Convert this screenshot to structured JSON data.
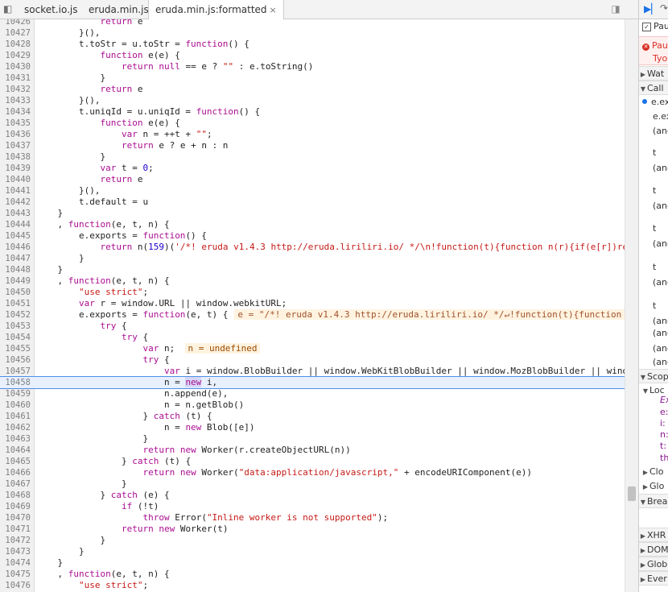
{
  "tabs": [
    {
      "label": "socket.io.js"
    },
    {
      "label": "eruda.min.js"
    },
    {
      "label": "eruda.min.js:formatted",
      "close": "×"
    }
  ],
  "code_lines": [
    {
      "n": "10426",
      "h": "            <span class=\"k\">return</span> e"
    },
    {
      "n": "10427",
      "h": "        }(),"
    },
    {
      "n": "10428",
      "h": "        t.toStr = u.toStr = <span class=\"k\">function</span>() {"
    },
    {
      "n": "10429",
      "h": "            <span class=\"k\">function</span> e(e) {"
    },
    {
      "n": "10430",
      "h": "                <span class=\"k\">return</span> <span class=\"k\">null</span> == e ? <span class=\"s\">\"\"</span> : e.toString()"
    },
    {
      "n": "10431",
      "h": "            }"
    },
    {
      "n": "10432",
      "h": "            <span class=\"k\">return</span> e"
    },
    {
      "n": "10433",
      "h": "        }(),"
    },
    {
      "n": "10434",
      "h": "        t.uniqId = u.uniqId = <span class=\"k\">function</span>() {"
    },
    {
      "n": "10435",
      "h": "            <span class=\"k\">function</span> e(e) {"
    },
    {
      "n": "10436",
      "h": "                <span class=\"k\">var</span> n = ++t + <span class=\"s\">\"\"</span>;"
    },
    {
      "n": "10437",
      "h": "                <span class=\"k\">return</span> e ? e + n : n"
    },
    {
      "n": "10438",
      "h": "            }"
    },
    {
      "n": "10439",
      "h": "            <span class=\"k\">var</span> t = <span class=\"n\">0</span>;"
    },
    {
      "n": "10440",
      "h": "            <span class=\"k\">return</span> e"
    },
    {
      "n": "10441",
      "h": "        }(),"
    },
    {
      "n": "10442",
      "h": "        t.default = u"
    },
    {
      "n": "10443",
      "h": "    }"
    },
    {
      "n": "10444",
      "h": "    , <span class=\"k\">function</span>(e, t, n) {"
    },
    {
      "n": "10445",
      "h": "        e.exports = <span class=\"k\">function</span>() {"
    },
    {
      "n": "10446",
      "h": "            <span class=\"k\">return</span> n(<span class=\"n\">159</span>)(<span class=\"s\">'/*! eruda v1.4.3 http://eruda.liriliri.io/ */\\n!function(t){function n(r){if(e[r])re</span>"
    },
    {
      "n": "10447",
      "h": "        }"
    },
    {
      "n": "10448",
      "h": "    }"
    },
    {
      "n": "10449",
      "h": "    , <span class=\"k\">function</span>(e, t, n) {"
    },
    {
      "n": "10450",
      "h": "        <span class=\"s\">\"use strict\"</span>;"
    },
    {
      "n": "10451",
      "h": "        <span class=\"k\">var</span> r = window.URL || window.webkitURL;"
    },
    {
      "n": "10452",
      "h": "        e.exports = <span class=\"k\">function</span>(e, t) {<span class=\"inl\">e = \"/*! eruda v1.4.3 http://eruda.liriliri.io/ */↵!function(t){function</span>"
    },
    {
      "n": "10453",
      "h": "            <span class=\"k\">try</span> {"
    },
    {
      "n": "10454",
      "h": "                <span class=\"k\">try</span> {"
    },
    {
      "n": "10455",
      "h": "                    <span class=\"k\">var</span> n;  <span class=\"inlbox\">n = undefined</span>"
    },
    {
      "n": "10456",
      "h": "                    <span class=\"k\">try</span> {"
    },
    {
      "n": "10457",
      "h": "                        <span class=\"k\">var</span> i = window.BlobBuilder || window.WebKitBlobBuilder || window.MozBlobBuilder || wind"
    },
    {
      "n": "10458",
      "h": "                        n = <span class=\"k hl\">new</span> i,",
      "exec": true
    },
    {
      "n": "10459",
      "h": "                        n.append(e),"
    },
    {
      "n": "10460",
      "h": "                        n = n.getBlob()"
    },
    {
      "n": "10461",
      "h": "                    } <span class=\"k\">catch</span> (t) {"
    },
    {
      "n": "10462",
      "h": "                        n = <span class=\"k\">new</span> Blob([e])"
    },
    {
      "n": "10463",
      "h": "                    }"
    },
    {
      "n": "10464",
      "h": "                    <span class=\"k\">return</span> <span class=\"k\">new</span> Worker(r.createObjectURL(n))"
    },
    {
      "n": "10465",
      "h": "                } <span class=\"k\">catch</span> (t) {"
    },
    {
      "n": "10466",
      "h": "                    <span class=\"k\">return</span> <span class=\"k\">new</span> Worker(<span class=\"s\">\"data:application/javascript,\"</span> + encodeURIComponent(e))"
    },
    {
      "n": "10467",
      "h": "                }"
    },
    {
      "n": "10468",
      "h": "            } <span class=\"k\">catch</span> (e) {"
    },
    {
      "n": "10469",
      "h": "                <span class=\"k\">if</span> (!t)"
    },
    {
      "n": "10470",
      "h": "                    <span class=\"k\">throw</span> Error(<span class=\"s\">\"Inline worker is not supported\"</span>);"
    },
    {
      "n": "10471",
      "h": "                <span class=\"k\">return</span> <span class=\"k\">new</span> Worker(t)"
    },
    {
      "n": "10472",
      "h": "            }"
    },
    {
      "n": "10473",
      "h": "        }"
    },
    {
      "n": "10474",
      "h": "    }"
    },
    {
      "n": "10475",
      "h": "    , <span class=\"k\">function</span>(e, t, n) {"
    },
    {
      "n": "10476",
      "h": "        <span class=\"s\">\"use strict\"</span>;"
    },
    {
      "n": "10477",
      "h": "        <span class=\"k\">function</span> r(e) {"
    }
  ],
  "sidebar": {
    "rows": [
      {
        "text": "Pau",
        "kind": "check"
      },
      {
        "text": "Pau",
        "kind": "paused-title"
      },
      {
        "text": "Tyo",
        "kind": "paused-sub"
      },
      {
        "text": "Wat",
        "kind": "section"
      },
      {
        "text": "Call",
        "kind": "section-open"
      },
      {
        "text": "e.ex",
        "kind": "frame-current"
      },
      {
        "text": "e.ex",
        "kind": "frame"
      },
      {
        "text": "(anc",
        "kind": "frame"
      },
      {
        "text": "t",
        "kind": "frame"
      },
      {
        "text": "(anc",
        "kind": "frame"
      },
      {
        "text": "t",
        "kind": "frame"
      },
      {
        "text": "(anc",
        "kind": "frame"
      },
      {
        "text": "t",
        "kind": "frame"
      },
      {
        "text": "(anc",
        "kind": "frame"
      },
      {
        "text": "t",
        "kind": "frame"
      },
      {
        "text": "(anc",
        "kind": "frame"
      },
      {
        "text": "t",
        "kind": "frame"
      },
      {
        "text": "(anc",
        "kind": "frame"
      },
      {
        "text": "(anc",
        "kind": "frame"
      },
      {
        "text": "(anc",
        "kind": "frame"
      },
      {
        "text": "(anc",
        "kind": "frame"
      },
      {
        "text": "Scop",
        "kind": "section-open"
      },
      {
        "text": "Loc",
        "kind": "subsection"
      },
      {
        "text": "Ex",
        "kind": "scope-var"
      },
      {
        "text": "e:",
        "kind": "scope-var"
      },
      {
        "text": "i:",
        "kind": "scope-var"
      },
      {
        "text": "n:",
        "kind": "scope-var"
      },
      {
        "text": "t:",
        "kind": "scope-var"
      },
      {
        "text": "th",
        "kind": "scope-var"
      },
      {
        "text": "Clo",
        "kind": "subsection"
      },
      {
        "text": "Glo",
        "kind": "subsection"
      },
      {
        "text": "Brea",
        "kind": "section-open"
      },
      {
        "text": "XHR",
        "kind": "section"
      },
      {
        "text": "DOM",
        "kind": "section"
      },
      {
        "text": "Glob",
        "kind": "section"
      },
      {
        "text": "Ever",
        "kind": "section"
      }
    ]
  }
}
